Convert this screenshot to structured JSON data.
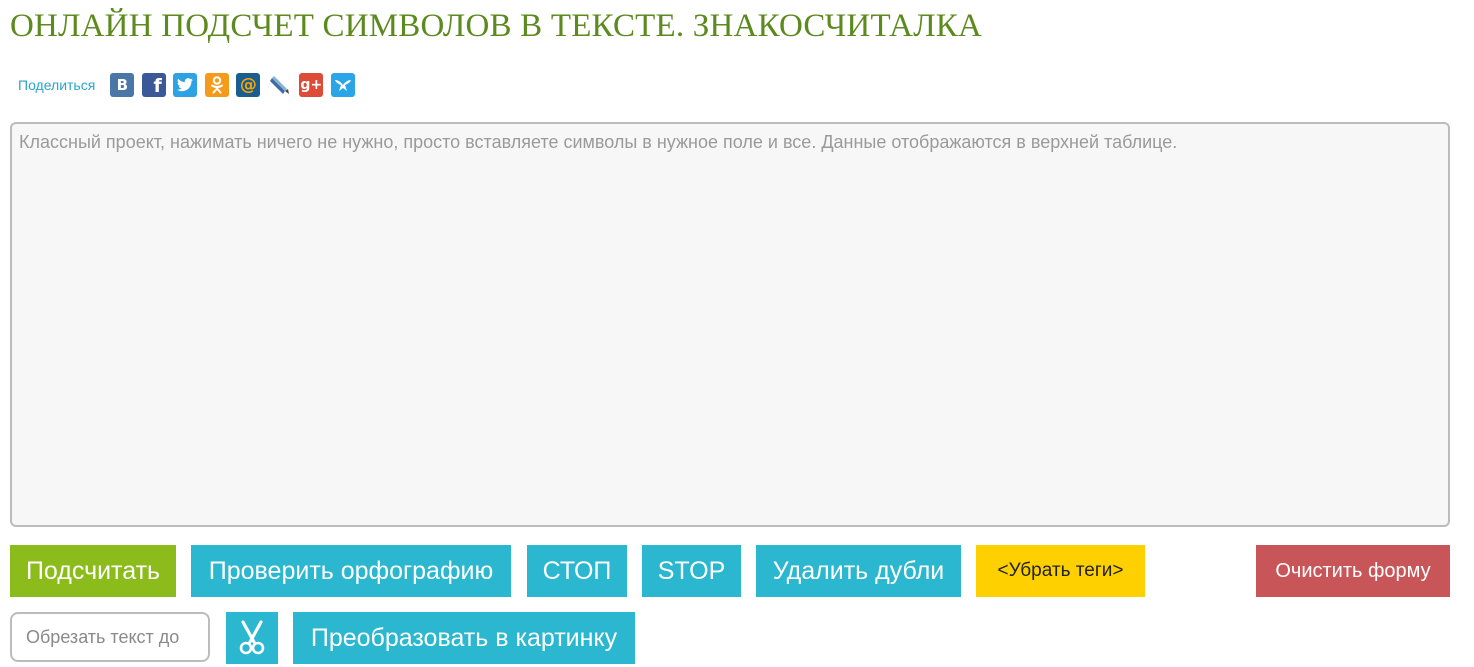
{
  "page": {
    "title": "ОНЛАЙН ПОДСЧЕТ СИМВОЛОВ В ТЕКСТЕ. ЗНАКОСЧИТАЛКА"
  },
  "share": {
    "label": "Поделиться",
    "icons": [
      {
        "name": "vk-icon",
        "glyph": "В",
        "color": "#4a76a8"
      },
      {
        "name": "facebook-icon",
        "glyph": "f",
        "color": "#3b5998"
      },
      {
        "name": "twitter-icon",
        "glyph": "",
        "color": "#2ea3e3"
      },
      {
        "name": "odnoklassniki-icon",
        "glyph": "",
        "color": "#f59a1b"
      },
      {
        "name": "mailru-icon",
        "glyph": "@",
        "color": "#168de2"
      },
      {
        "name": "livejournal-icon",
        "glyph": "",
        "color": "#ffffff"
      },
      {
        "name": "googleplus-icon",
        "glyph": "g+",
        "color": "#dd4b39"
      },
      {
        "name": "moimir-icon",
        "glyph": "",
        "color": "#2aa6e8"
      }
    ]
  },
  "editor": {
    "placeholder": "Классный проект, нажимать ничего не нужно, просто вставляете символы в нужное поле и все. Данные отображаются в верхней таблице.",
    "value": ""
  },
  "toolbar": {
    "count_label": "Подсчитать",
    "spellcheck_label": "Проверить орфографию",
    "stop_ru_label": "СТОП",
    "stop_en_label": "STOP",
    "dedupe_label": "Удалить дубли",
    "strip_tags_label": "<Убрать теги>",
    "clear_label": "Очистить форму",
    "cut_placeholder": "Обрезать текст до",
    "cut_icon": "scissors-icon",
    "to_image_label": "Преобразовать в картинку"
  },
  "colors": {
    "title": "#5c8a1f",
    "accent_green": "#8cbc1c",
    "accent_blue": "#2bb7cf",
    "accent_yellow": "#ffd000",
    "accent_red": "#c85659"
  }
}
